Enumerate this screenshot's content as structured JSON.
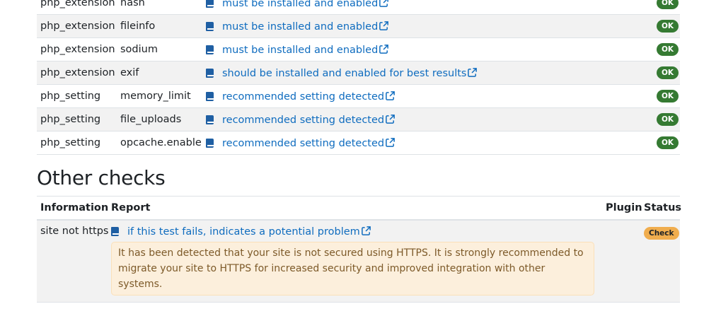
{
  "env_rows": [
    {
      "type": "php_extension",
      "name": "hash",
      "report": "must be installed and enabled",
      "status": "OK"
    },
    {
      "type": "php_extension",
      "name": "fileinfo",
      "report": "must be installed and enabled",
      "status": "OK"
    },
    {
      "type": "php_extension",
      "name": "sodium",
      "report": "must be installed and enabled",
      "status": "OK"
    },
    {
      "type": "php_extension",
      "name": "exif",
      "report": "should be installed and enabled for best results",
      "status": "OK"
    },
    {
      "type": "php_setting",
      "name": "memory_limit",
      "report": "recommended setting detected",
      "status": "OK"
    },
    {
      "type": "php_setting",
      "name": "file_uploads",
      "report": "recommended setting detected",
      "status": "OK"
    },
    {
      "type": "php_setting",
      "name": "opcache.enable",
      "report": "recommended setting detected",
      "status": "OK"
    }
  ],
  "other_checks": {
    "title": "Other checks",
    "headers": {
      "information": "Information",
      "report": "Report",
      "plugin": "Plugin",
      "status": "Status"
    },
    "rows": [
      {
        "information": "site not https",
        "report": "if this test fails, indicates a potential problem",
        "alert": "It has been detected that your site is not secured using HTTPS. It is strongly recommended to migrate your site to HTTPS for increased security and improved integration with other systems.",
        "plugin": "",
        "status": "Check"
      }
    ]
  },
  "colors": {
    "link": "#0f6cbf",
    "ok_badge": "#357a32",
    "check_badge": "#f0ad4e",
    "alert_bg": "#fcefdc"
  },
  "icons": {
    "doc": "book-icon",
    "external": "external-link-icon"
  }
}
